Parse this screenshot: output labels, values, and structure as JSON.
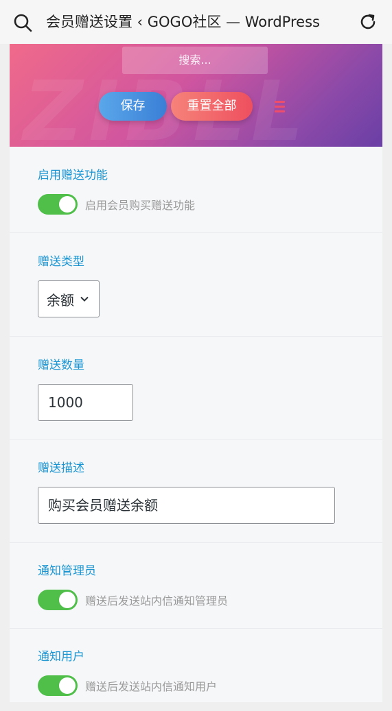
{
  "topbar": {
    "title": "会员赠送设置 ‹ GOGO社区 — WordPress"
  },
  "header": {
    "watermark": "ZIBLL",
    "search_placeholder": "搜索...",
    "save_label": "保存",
    "reset_label": "重置全部"
  },
  "sections": {
    "enable": {
      "label": "启用赠送功能",
      "toggle_on": true,
      "desc": "启用会员购买赠送功能"
    },
    "type": {
      "label": "赠送类型",
      "selected": "余额"
    },
    "amount": {
      "label": "赠送数量",
      "value": "1000"
    },
    "description": {
      "label": "赠送描述",
      "value": "购买会员赠送余额"
    },
    "notify_admin": {
      "label": "通知管理员",
      "toggle_on": true,
      "desc": "赠送后发送站内信通知管理员"
    },
    "notify_user": {
      "label": "通知用户",
      "toggle_on": true,
      "desc": "赠送后发送站内信通知用户"
    }
  },
  "colors": {
    "accent_label": "#1b95d2",
    "toggle_on": "#4fbf4a"
  }
}
